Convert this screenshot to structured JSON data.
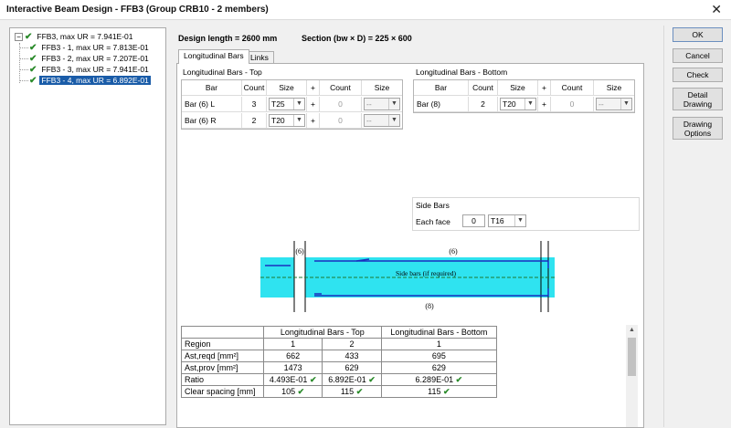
{
  "window": {
    "title": "Interactive Beam Design - FFB3 (Group CRB10 - 2 members)",
    "close_glyph": "✕"
  },
  "tree": {
    "root": {
      "expander": "−",
      "check": "✔",
      "label": "FFB3, max UR = 7.941E-01"
    },
    "items": [
      {
        "check": "✔",
        "label": "FFB3 - 1, max UR = 7.813E-01"
      },
      {
        "check": "✔",
        "label": "FFB3 - 2, max UR = 7.207E-01"
      },
      {
        "check": "✔",
        "label": "FFB3 - 3, max UR = 7.941E-01"
      },
      {
        "check": "✔",
        "label": "FFB3 - 4, max UR = 6.892E-01"
      }
    ]
  },
  "design_length": "Design length = 2600 mm",
  "section": "Section (bw × D) = 225 × 600",
  "tabs": [
    "Longitudinal Bars",
    "Links"
  ],
  "top_bars": {
    "title": "Longitudinal Bars - Top",
    "headers": [
      "Bar",
      "Count",
      "Size",
      "+",
      "Count",
      "Size"
    ],
    "rows": [
      {
        "bar": "Bar (6) L",
        "count": "3",
        "size": "T25",
        "plus": "+",
        "count2": "0",
        "size2": "--"
      },
      {
        "bar": "Bar (6) R",
        "count": "2",
        "size": "T20",
        "plus": "+",
        "count2": "0",
        "size2": "--"
      }
    ]
  },
  "bottom_bars": {
    "title": "Longitudinal Bars - Bottom",
    "headers": [
      "Bar",
      "Count",
      "Size",
      "+",
      "Count",
      "Size"
    ],
    "rows": [
      {
        "bar": "Bar (8)",
        "count": "2",
        "size": "T20",
        "plus": "+",
        "count2": "0",
        "size2": "--"
      }
    ]
  },
  "side_bars": {
    "title": "Side Bars",
    "label": "Each face",
    "count": "0",
    "size": "T16"
  },
  "drawing": {
    "top_left_label": "(6)",
    "top_mid_label": "(6)",
    "bottom_label": "(8)",
    "side_text": "Side bars (if required)",
    "colors": {
      "beam": "#2fe3f0",
      "bars": "#1a2fbf",
      "side": "#1d7a2f"
    }
  },
  "results": {
    "header": [
      "",
      "Longitudinal Bars - Top",
      "Longitudinal Bars - Bottom"
    ],
    "rows": [
      {
        "label": "Region",
        "v1": "1",
        "v2": "2",
        "v3": "1",
        "ok1": "",
        "ok2": "",
        "ok3": ""
      },
      {
        "label": "Ast,reqd [mm²]",
        "v1": "662",
        "v2": "433",
        "v3": "695",
        "ok1": "",
        "ok2": "",
        "ok3": ""
      },
      {
        "label": "Ast,prov [mm²]",
        "v1": "1473",
        "v2": "629",
        "v3": "629",
        "ok1": "",
        "ok2": "",
        "ok3": ""
      },
      {
        "label": "Ratio",
        "v1": "4.493E-01",
        "v2": "6.892E-01",
        "v3": "6.289E-01",
        "ok1": "✔",
        "ok2": "✔",
        "ok3": "✔"
      },
      {
        "label": "Clear spacing [mm]",
        "v1": "105",
        "v2": "115",
        "v3": "115",
        "ok1": "✔",
        "ok2": "✔",
        "ok3": "✔"
      }
    ]
  },
  "buttons": [
    "OK",
    "Cancel",
    "Check",
    "Detail Drawing",
    "Drawing Options"
  ]
}
